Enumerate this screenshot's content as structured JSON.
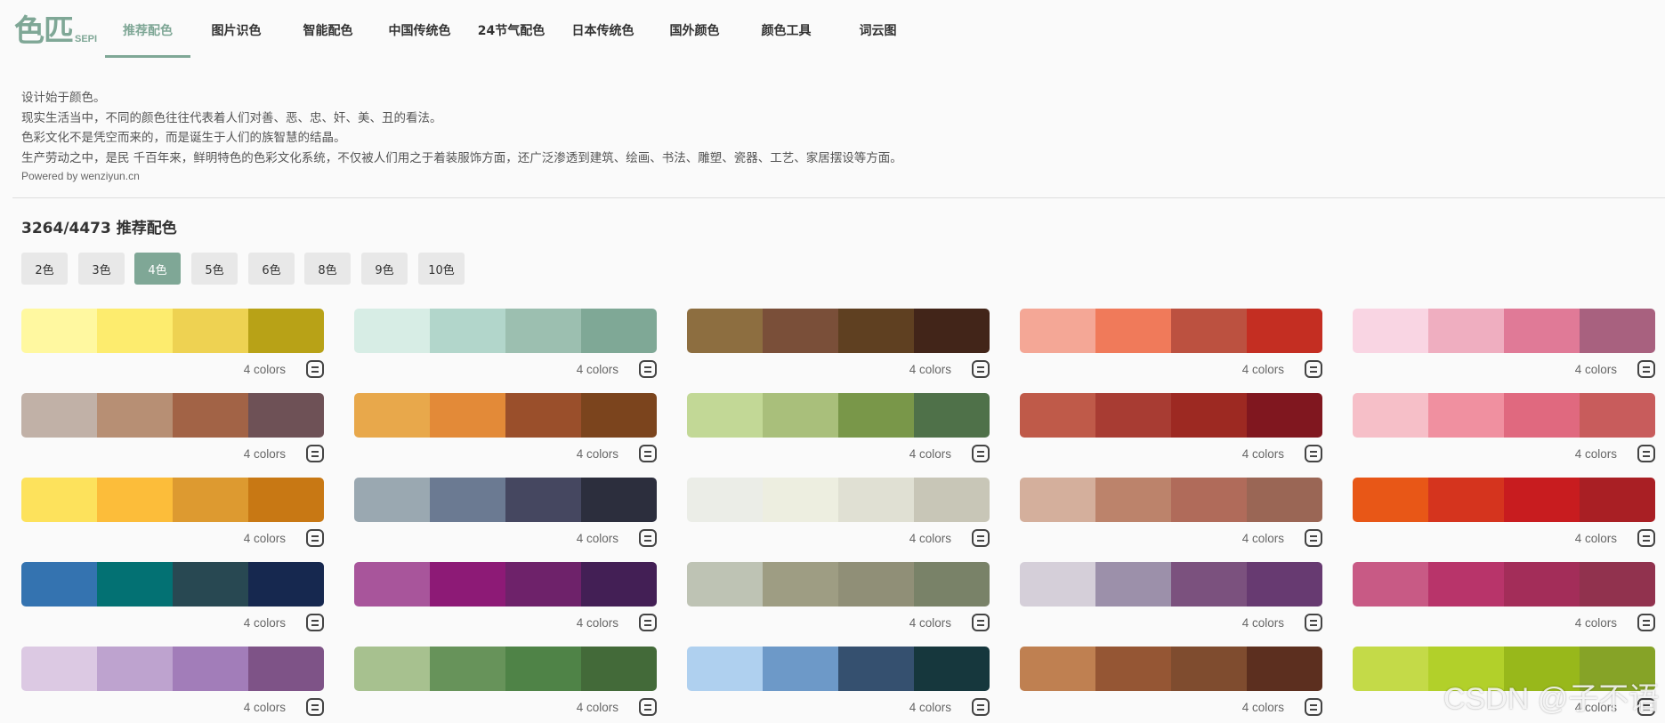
{
  "logo": {
    "main": "色匹",
    "sub": "SEPI"
  },
  "nav": [
    {
      "label": "推荐配色",
      "active": true
    },
    {
      "label": "图片识色",
      "active": false
    },
    {
      "label": "智能配色",
      "active": false
    },
    {
      "label": "中国传统色",
      "active": false
    },
    {
      "label": "24节气配色",
      "active": false
    },
    {
      "label": "日本传统色",
      "active": false
    },
    {
      "label": "国外颜色",
      "active": false
    },
    {
      "label": "颜色工具",
      "active": false
    },
    {
      "label": "词云图",
      "active": false
    }
  ],
  "intro": {
    "lines": [
      "设计始于颜色。",
      "现实生活当中，不同的颜色往往代表着人们对善、恶、忠、奸、美、丑的看法。",
      "色彩文化不是凭空而来的，而是诞生于人们的族智慧的结晶。",
      "生产劳动之中，是民 千百年来，鲜明特色的色彩文化系统，不仅被人们用之于着装服饰方面，还广泛渗透到建筑、绘画、书法、雕塑、瓷器、工艺、家居摆设等方面。"
    ],
    "powered": "Powered by wenziyun.cn"
  },
  "count_title": "3264/4473 推荐配色",
  "filters": [
    {
      "label": "2色",
      "active": false
    },
    {
      "label": "3色",
      "active": false
    },
    {
      "label": "4色",
      "active": true
    },
    {
      "label": "5色",
      "active": false
    },
    {
      "label": "6色",
      "active": false
    },
    {
      "label": "8色",
      "active": false
    },
    {
      "label": "9色",
      "active": false
    },
    {
      "label": "10色",
      "active": false
    }
  ],
  "palette_count_label": "4 colors",
  "palettes": [
    [
      "#fff8a0",
      "#fdec6e",
      "#eed252",
      "#b8a217"
    ],
    [
      "#d7ede5",
      "#b2d6cb",
      "#9cbfb0",
      "#7fa896"
    ],
    [
      "#8d6e40",
      "#7a4f39",
      "#5f4021",
      "#422519"
    ],
    [
      "#f4a796",
      "#f07a5a",
      "#bc5140",
      "#c42e22"
    ],
    [
      "#f9d5e3",
      "#efaec0",
      "#e07a97",
      "#a8617f"
    ],
    [
      "#c1b1a7",
      "#b78f74",
      "#a26346",
      "#6e5156"
    ],
    [
      "#e8a84b",
      "#e38a38",
      "#9a4f2b",
      "#7b441d"
    ],
    [
      "#c2d896",
      "#a9bf7b",
      "#799749",
      "#4f7149"
    ],
    [
      "#bf5a49",
      "#a83c33",
      "#9d2922",
      "#80171f"
    ],
    [
      "#f6bfc8",
      "#f090a0",
      "#e0697f",
      "#c85c5c"
    ],
    [
      "#fde25c",
      "#fcbd3a",
      "#dd9a30",
      "#c87814"
    ],
    [
      "#9aa8b1",
      "#6b7a92",
      "#454760",
      "#2c2e3d"
    ],
    [
      "#ebede7",
      "#edeee0",
      "#e0e0d3",
      "#c8c6b7"
    ],
    [
      "#d4af9c",
      "#bc836b",
      "#b06b5a",
      "#9a6655"
    ],
    [
      "#e85717",
      "#d5341e",
      "#c81c1f",
      "#a91f24"
    ],
    [
      "#3473b0",
      "#037173",
      "#284852",
      "#16284f"
    ],
    [
      "#a8559b",
      "#8d1a76",
      "#6e226a",
      "#431f55"
    ],
    [
      "#bec3b4",
      "#9e9d83",
      "#908f77",
      "#798268"
    ],
    [
      "#d5cfd9",
      "#9c90aa",
      "#7b517e",
      "#673a71"
    ],
    [
      "#c85a85",
      "#b8346a",
      "#a32d59",
      "#91324e"
    ],
    [
      "#dcc9e3",
      "#bea3cf",
      "#a27db9",
      "#7e5387"
    ],
    [
      "#a7c18f",
      "#67935a",
      "#4f8347",
      "#436a39"
    ],
    [
      "#afd0ef",
      "#6d99c8",
      "#35506f",
      "#16373d"
    ],
    [
      "#bf8051",
      "#955634",
      "#7f4c2f",
      "#5c2f1f"
    ],
    [
      "#c4da48",
      "#b2d02a",
      "#98b81b",
      "#86a327"
    ]
  ],
  "watermark": "CSDN @子不语"
}
